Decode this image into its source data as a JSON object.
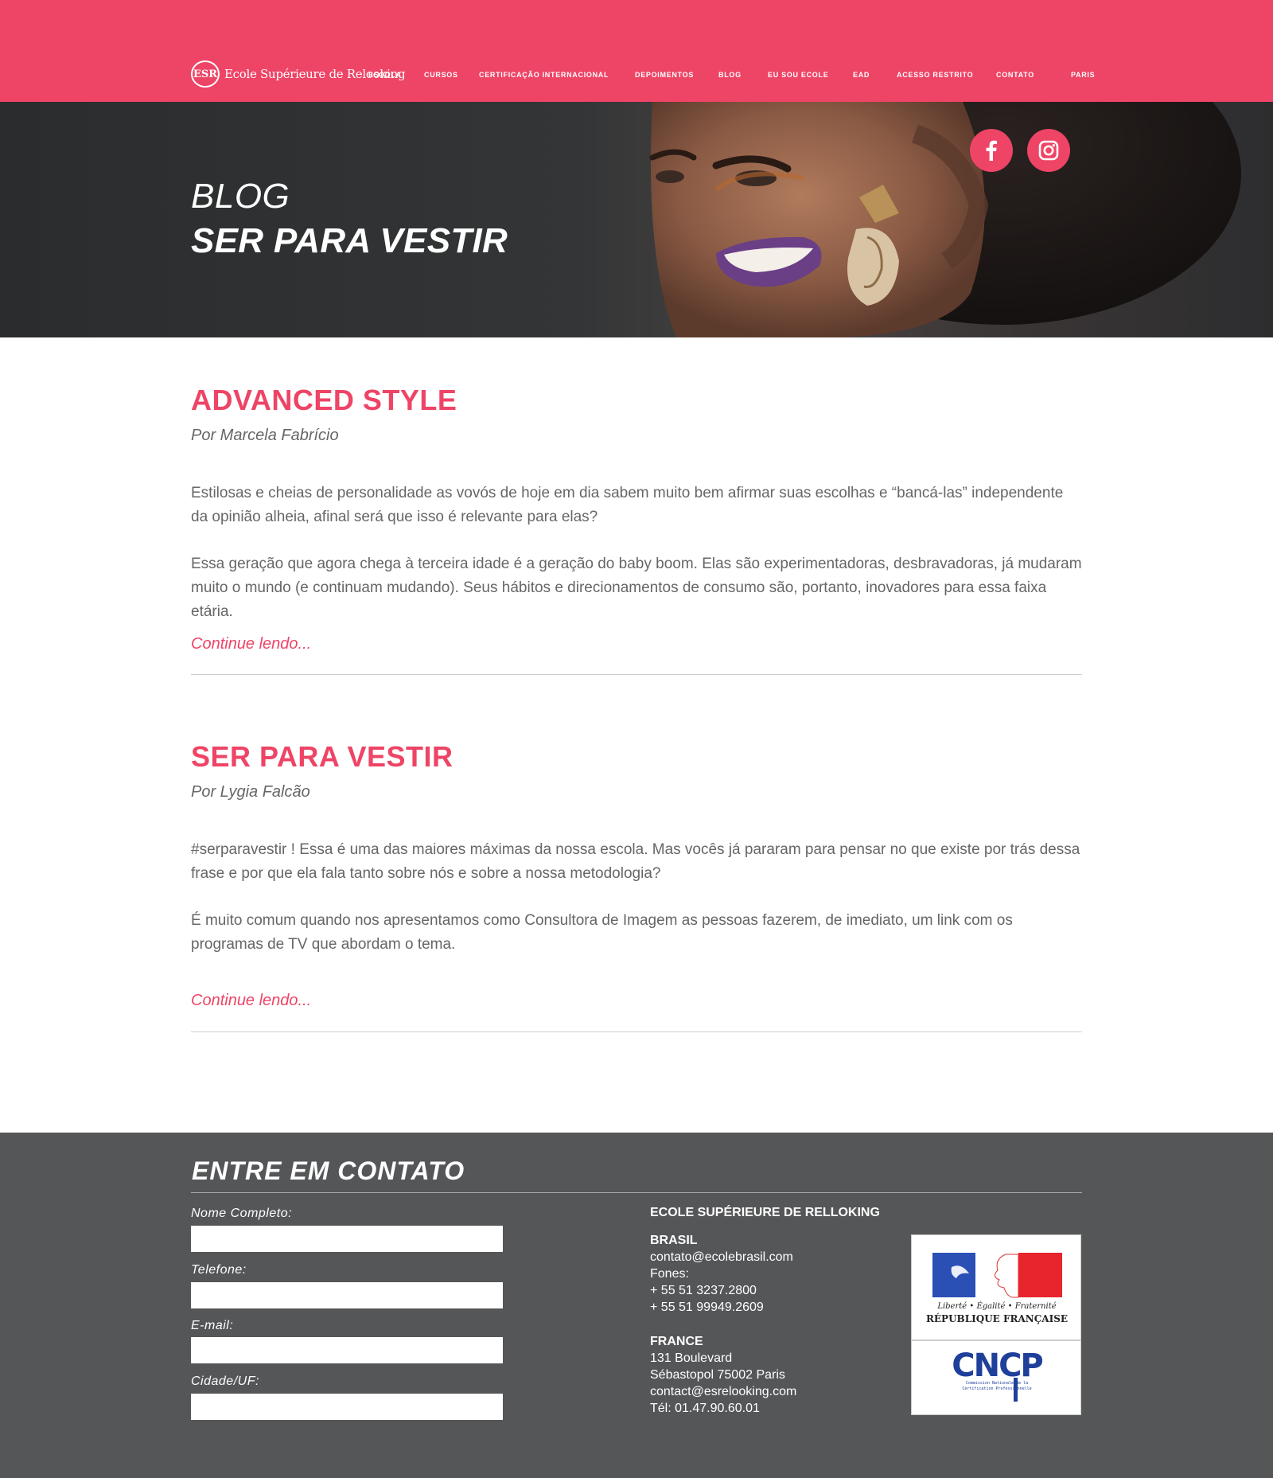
{
  "brand": {
    "mark": "ESR",
    "name": "Ecole Supérieure de Relooking"
  },
  "nav": [
    "ESCOLA",
    "CURSOS",
    "CERTIFICAÇÃO INTERNACIONAL",
    "DEPOIMENTOS",
    "BLOG",
    "EU SOU ECOLE",
    "EAD",
    "ACESSO RESTRITO",
    "CONTATO",
    "PARIS"
  ],
  "hero": {
    "kicker": "BLOG",
    "title": "SER PARA VESTIR"
  },
  "posts": [
    {
      "title": "ADVANCED STYLE",
      "author": "Por Marcela Fabrício",
      "paragraphs": [
        "Estilosas e cheias de personalidade as vovós de hoje em dia sabem muito bem afirmar suas escolhas e “bancá-las” independente da opinião alheia, afinal será que isso é relevante para elas?",
        "Essa geração que agora chega à terceira idade é a geração do baby boom. Elas são experimentadoras, desbravadoras, já mudaram muito o mundo (e continuam mudando). Seus hábitos e direcionamentos de consumo são, portanto, inovadores para essa faixa etária."
      ],
      "link": "Continue lendo..."
    },
    {
      "title": "SER PARA VESTIR",
      "author": "Por Lygia Falcão",
      "paragraphs": [
        "#serparavestir ! Essa é uma das maiores máximas da nossa escola. Mas vocês já pararam para pensar no que existe por trás dessa frase e por que ela fala tanto sobre nós e sobre a nossa metodologia?",
        " É muito comum quando nos apresentamos como Consultora de Imagem as pessoas fazerem, de imediato, um link com os programas de TV que abordam o tema."
      ],
      "link": "Continue lendo..."
    }
  ],
  "footer": {
    "title": "ENTRE EM CONTATO",
    "form": [
      {
        "label": "Nome Completo:",
        "value": ""
      },
      {
        "label": "Telefone:",
        "value": ""
      },
      {
        "label": "E-mail:",
        "value": ""
      },
      {
        "label": "Cidade/UF:",
        "value": ""
      }
    ],
    "org": "ECOLE SUPÉRIEURE DE RELLOKING",
    "brasil": {
      "heading": "BRASIL",
      "email": "contato@ecolebrasil.com",
      "phones_label": "Fones:",
      "phone1": "+ 55 51 3237.2800",
      "phone2": "+ 55 51 99949.2609"
    },
    "france": {
      "heading": "FRANCE",
      "line1": "131 Boulevard",
      "line2": "Sébastopol 75002 Paris",
      "email": "contact@esrelooking.com",
      "tel": "Tél: 01.47.90.60.01"
    },
    "badges": {
      "republique_motto": "Liberté • Égalité • Fraternité",
      "republique_name": "RÉPUBLIQUE FRANÇAISE",
      "cncp_logo": "CNCP",
      "cncp_text": "Commission Nationale de la Certification Professionnelle"
    }
  },
  "colors": {
    "accent": "#ee4466",
    "footer_bg": "#555658",
    "hero_bg": "#2f3132"
  },
  "icons": [
    "facebook-icon",
    "instagram-icon"
  ]
}
